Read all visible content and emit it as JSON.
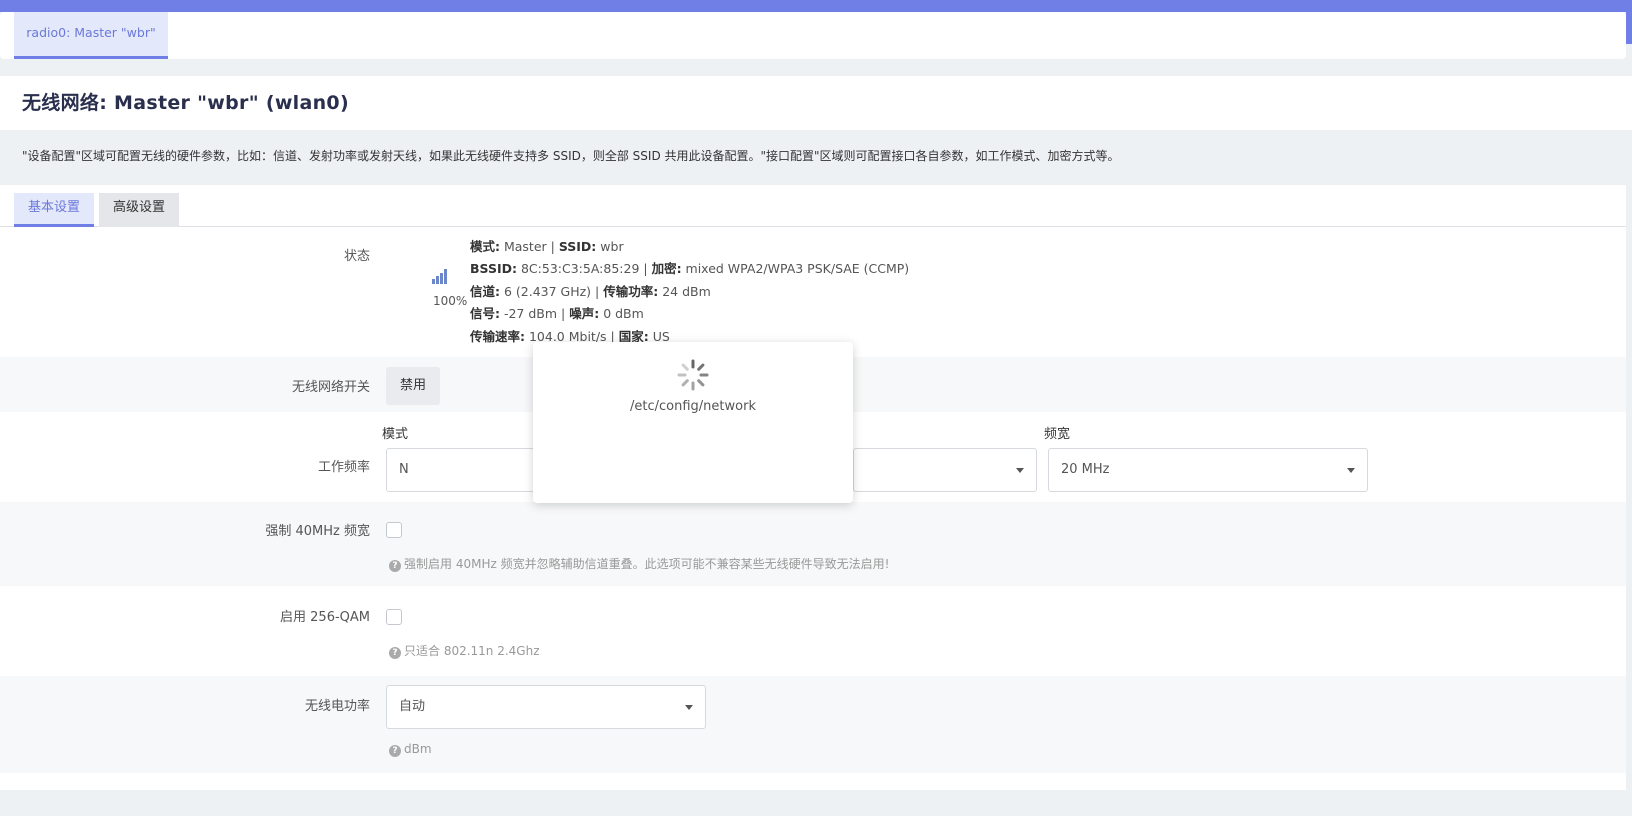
{
  "radio_tab": {
    "label": "radio0: Master \"wbr\""
  },
  "header": {
    "title": "无线网络: Master \"wbr\" (wlan0)"
  },
  "description": "\"设备配置\"区域可配置无线的硬件参数，比如：信道、发射功率或发射天线，如果此无线硬件支持多 SSID，则全部 SSID 共用此设备配置。\"接口配置\"区域则可配置接口各自参数，如工作模式、加密方式等。",
  "tabs": [
    {
      "label": "基本设置",
      "active": true
    },
    {
      "label": "高级设置",
      "active": false
    }
  ],
  "status": {
    "label": "状态",
    "signal_icon": "signal-bars-icon",
    "percent": "100%",
    "mode_label": "模式:",
    "mode_value": " Master | ",
    "ssid_label": "SSID:",
    "ssid_value": " wbr",
    "bssid_label": "BSSID:",
    "bssid_value": " 8C:53:C3:5A:85:29 | ",
    "enc_label": "加密:",
    "enc_value": " mixed WPA2/WPA3 PSK/SAE (CCMP)",
    "channel_label": "信道:",
    "channel_value": " 6 (2.437 GHz) | ",
    "txpower_label": "传输功率:",
    "txpower_value": " 24 dBm",
    "signal_label": "信号:",
    "signal_value": " -27 dBm | ",
    "noise_label": "噪声:",
    "noise_value": " 0 dBm",
    "rate_label": "传输速率:",
    "rate_value": " 104.0 Mbit/s | ",
    "country_label": "国家:",
    "country_value": " US"
  },
  "wireless_switch": {
    "label": "无线网络开关",
    "button": "禁用"
  },
  "frequency": {
    "label": "工作频率",
    "mode_label": "模式",
    "mode_value": "N",
    "width_label": "频宽",
    "width_value": "20 MHz"
  },
  "force40": {
    "label": "强制 40MHz 频宽",
    "help": "强制启用 40MHz 频宽并忽略辅助信道重叠。此选项可能不兼容某些无线硬件导致无法启用!"
  },
  "qam256": {
    "label": "启用 256-QAM",
    "help": "只适合 802.11n 2.4Ghz"
  },
  "txpower": {
    "label": "无线电功率",
    "value": "自动",
    "help": "dBm"
  },
  "loading_modal": {
    "text": "/etc/config/network"
  },
  "colors": {
    "accent": "#6f7fe6",
    "tab_active_bg": "#e3e8fb"
  }
}
